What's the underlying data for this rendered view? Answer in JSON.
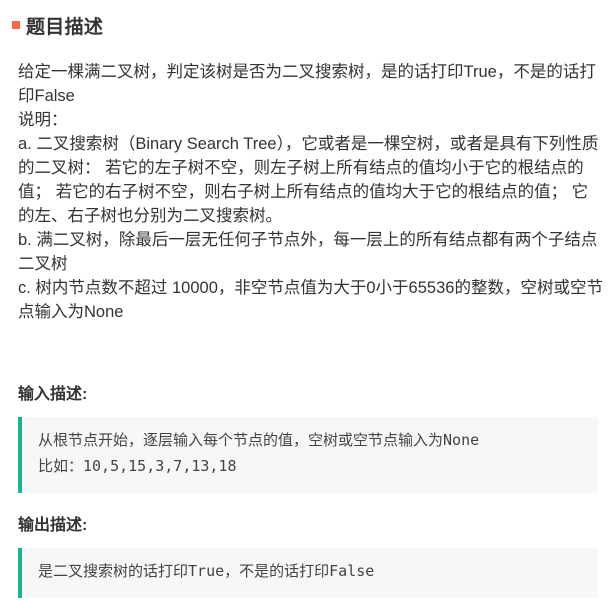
{
  "header": {
    "title": "题目描述",
    "accent_color": "#f46a4f"
  },
  "description": {
    "paragraphs": [
      "给定一棵满二叉树，判定该树是否为二叉搜索树，是的话打印True，不是的话打印False",
      "说明：",
      "a. 二叉搜索树（Binary Search Tree），它或者是一棵空树，或者是具有下列性质的二叉树： 若它的左子树不空，则左子树上所有结点的值均小于它的根结点的值； 若它的右子树不空，则右子树上所有结点的值均大于它的根结点的值； 它的左、右子树也分别为二叉搜索树。",
      "b. 满二叉树，除最后一层无任何子节点外，每一层上的所有结点都有两个子结点二叉树",
      "c. 树内节点数不超过 10000，非空节点值为大于0小于65536的整数，空树或空节点输入为None"
    ]
  },
  "input_section": {
    "heading": "输入描述:",
    "lines": [
      "从根节点开始，逐层输入每个节点的值，空树或空节点输入为None",
      "比如：10,5,15,3,7,13,18"
    ]
  },
  "output_section": {
    "heading": "输出描述:",
    "lines": [
      "是二叉搜索树的话打印True，不是的话打印False"
    ]
  },
  "colors": {
    "code_border": "#1ab394",
    "code_background": "#f6f7f8"
  }
}
